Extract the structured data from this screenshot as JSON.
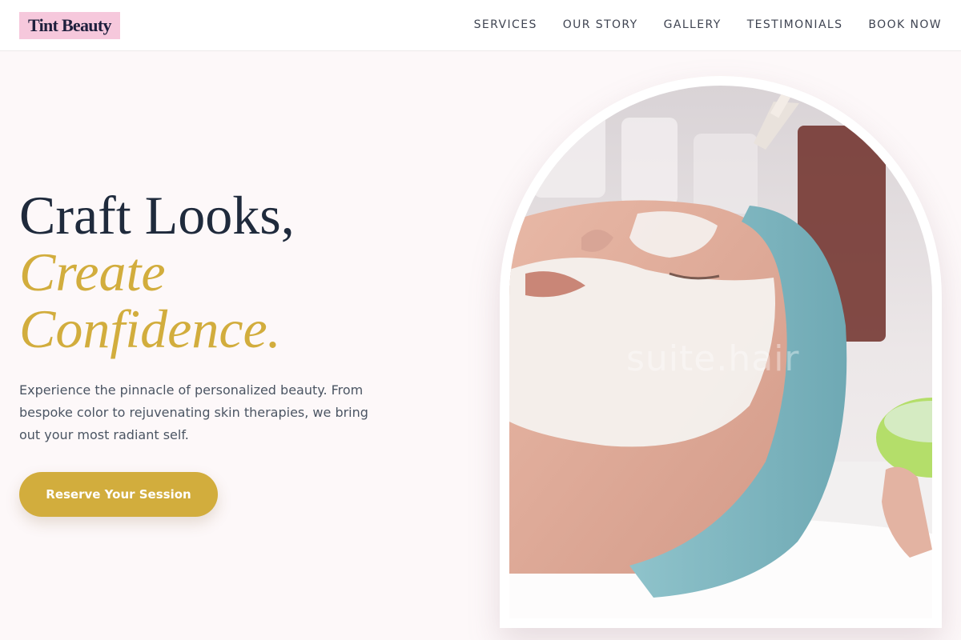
{
  "brand": {
    "name": "Tint Beauty"
  },
  "nav": {
    "items": [
      {
        "label": "SERVICES"
      },
      {
        "label": "OUR STORY"
      },
      {
        "label": "GALLERY"
      },
      {
        "label": "TESTIMONIALS"
      },
      {
        "label": "BOOK NOW"
      }
    ]
  },
  "hero": {
    "title_line1": "Craft Looks,",
    "title_line2": "Create",
    "title_line3": "Confidence.",
    "description": "Experience the pinnacle of personalized beauty. From bespoke color to rejuvenating skin therapies, we bring out your most radiant self.",
    "cta_label": "Reserve Your Session",
    "image_watermark": "suite.hair"
  },
  "colors": {
    "brand_pink": "#f6c8dc",
    "accent_gold": "#d2ad3d",
    "heading_navy": "#1f2a3c",
    "page_background": "#fdf8f9"
  }
}
